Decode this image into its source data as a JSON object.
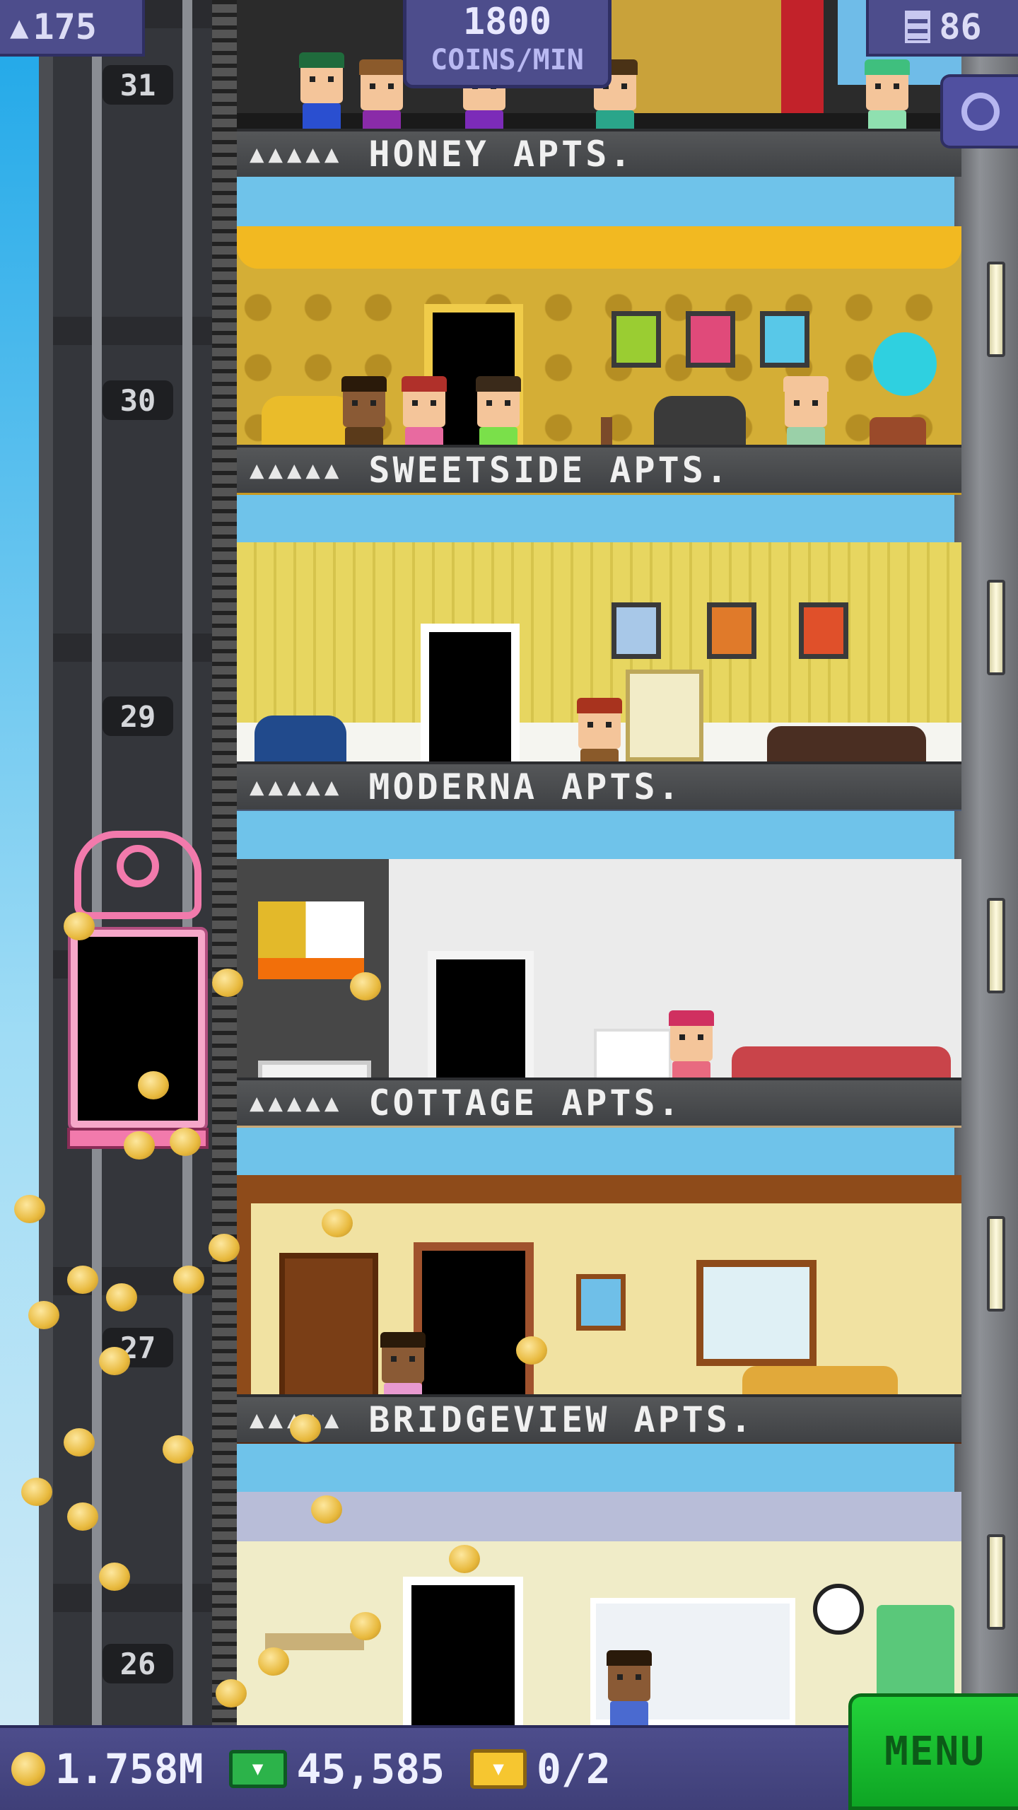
{
  "hud": {
    "population": "175",
    "population_icon": "person-icon",
    "coins_rate": "1800",
    "coins_rate_unit": "COINS/MIN",
    "floors_count": "86",
    "floors_icon": "building-icon",
    "search_icon": "magnifier-icon"
  },
  "elevator": {
    "floor_numbers": [
      "31",
      "30",
      "29",
      "27",
      "26"
    ]
  },
  "floors": [
    {
      "name": "HONEY APTS.",
      "pips": "▲▲▲▲▲"
    },
    {
      "name": "SWEETSIDE APTS.",
      "pips": "▲▲▲▲▲"
    },
    {
      "name": "MODERNA APTS.",
      "pips": "▲▲▲▲▲"
    },
    {
      "name": "COTTAGE APTS.",
      "pips": "▲▲▲▲▲"
    },
    {
      "name": "BRIDGEVIEW APTS.",
      "pips": "▲▲▲▲▲"
    }
  ],
  "bottom_bar": {
    "coins": "1.758M",
    "bux": "45,585",
    "chests": "0/2",
    "menu_label": "MENU"
  },
  "colors": {
    "hud_bg": "#4d4d8c",
    "menu_green": "#23d33a",
    "coin_gold": "#e8b93d",
    "elevator_pink": "#f27aac"
  }
}
